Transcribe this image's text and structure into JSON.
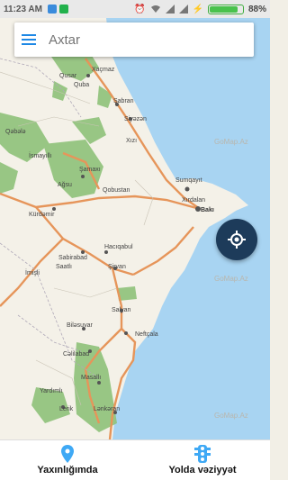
{
  "status_bar": {
    "time": "11:23 AM",
    "battery": "88%",
    "battery_level": 0.88,
    "icons": [
      "location-notification-icon",
      "chat-notification-icon",
      "alarm-icon",
      "wifi-icon",
      "signal-icon",
      "signal-icon",
      "charging-icon"
    ]
  },
  "search": {
    "placeholder": "Axtar"
  },
  "map": {
    "watermark": "GoMap.Az",
    "labels": {
      "xacmaz": "Xaçmaz",
      "quba": "Quba",
      "qusar": "Qusar",
      "sabran": "Şabran",
      "siyazan": "Siyəzən",
      "qabala": "Qəbələ",
      "ismayilli": "İsmayıllı",
      "xizi": "Xızı",
      "samaxi": "Şamaxı",
      "agsu": "Ağsu",
      "qobustan": "Qobustan",
      "sumqayit": "Sumqayıt",
      "xirdalan": "Xırdalan",
      "baki": "Bakı",
      "kurdamir": "Kürdəmir",
      "sabirabad": "Sabirabad",
      "haciqabul": "Hacıqabul",
      "saatli": "Saatlı",
      "sirvan": "Şirvan",
      "imisli": "İmişli",
      "salyan": "Salyan",
      "bilasuvar": "Biləsuvar",
      "neftcala": "Neftçala",
      "calilabad": "Cəlilabad",
      "masalli": "Masallı",
      "yardimli": "Yardımlı",
      "lerik": "Lerik",
      "lankaran": "Lənkəran"
    }
  },
  "bottom_nav": {
    "nearby_label": "Yaxınlığımda",
    "traffic_label": "Yolda vəziyyət"
  },
  "colors": {
    "accent": "#1e88e5",
    "locate_button": "#1d3b5a",
    "sea": "#a8d4f2",
    "land": "#f4f1e8",
    "forest": "#8fc27a",
    "road": "#e6955a"
  }
}
